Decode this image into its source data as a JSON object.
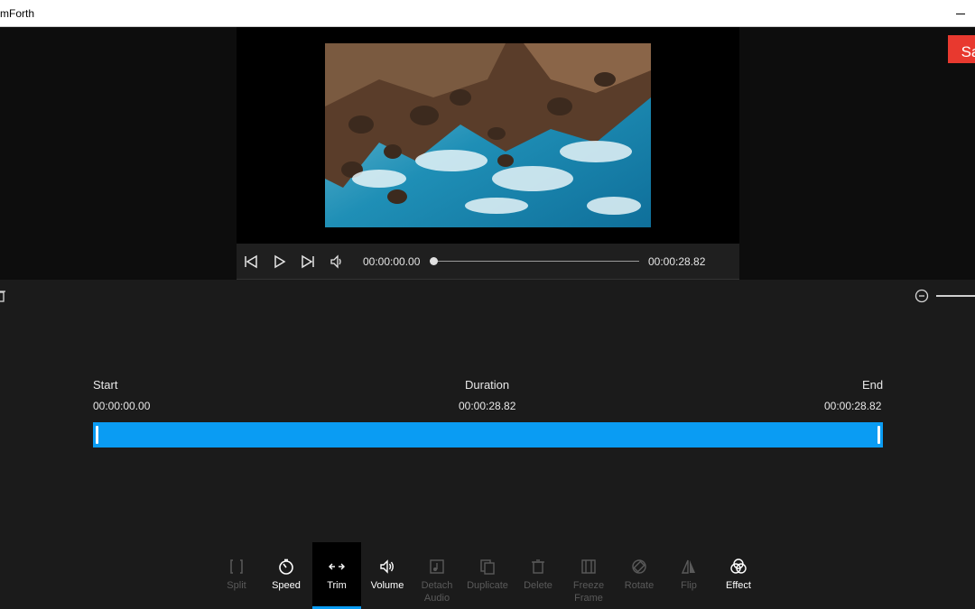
{
  "window": {
    "title": "mForth"
  },
  "player": {
    "current_time": "00:00:00.00",
    "total_time": "00:00:28.82",
    "progress": 0
  },
  "save_button": {
    "label": "Sa"
  },
  "trim": {
    "start_label": "Start",
    "start_value": "00:00:00.00",
    "duration_label": "Duration",
    "duration_value": "00:00:28.82",
    "end_label": "End",
    "end_value": "00:00:28.82"
  },
  "toolbar": {
    "split": "Split",
    "speed": "Speed",
    "trim": "Trim",
    "volume": "Volume",
    "detach_audio_1": "Detach",
    "detach_audio_2": "Audio",
    "duplicate": "Duplicate",
    "delete": "Delete",
    "freeze_frame_1": "Freeze",
    "freeze_frame_2": "Frame",
    "rotate": "Rotate",
    "flip": "Flip",
    "effect": "Effect"
  },
  "colors": {
    "accent": "#0a9cf3",
    "save": "#e8392f",
    "background": "#1b1b1b"
  }
}
